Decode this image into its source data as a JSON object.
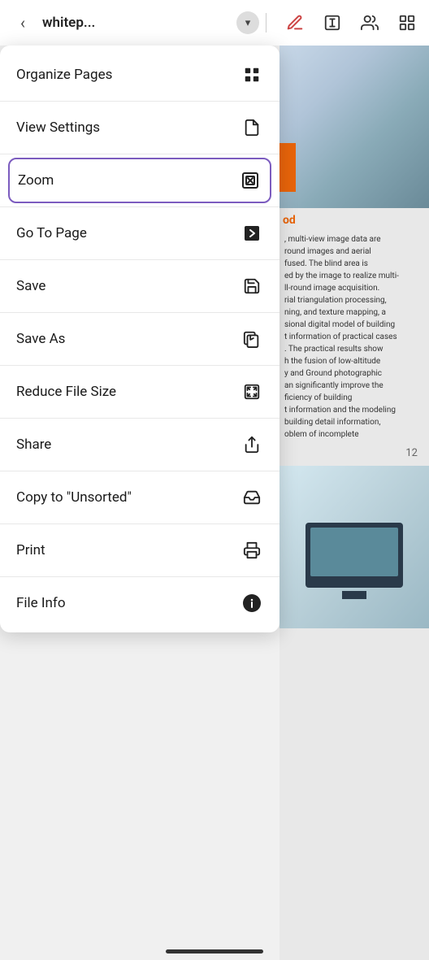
{
  "header": {
    "back_label": "‹",
    "title": "whitep...",
    "dropdown_icon": "▾",
    "icons": [
      {
        "name": "annotate-icon",
        "symbol": "✏️"
      },
      {
        "name": "text-tool-icon",
        "symbol": "T"
      },
      {
        "name": "share-people-icon",
        "symbol": "👥"
      },
      {
        "name": "apps-icon",
        "symbol": "⠿"
      }
    ]
  },
  "menu": {
    "items": [
      {
        "id": "organize-pages",
        "label": "Organize Pages",
        "icon": "grid-icon",
        "active": false
      },
      {
        "id": "view-settings",
        "label": "View Settings",
        "icon": "document-icon",
        "active": false
      },
      {
        "id": "zoom",
        "label": "Zoom",
        "icon": "zoom-icon",
        "active": true
      },
      {
        "id": "go-to-page",
        "label": "Go To Page",
        "icon": "arrow-right-icon",
        "active": false
      },
      {
        "id": "save",
        "label": "Save",
        "icon": "save-icon",
        "active": false
      },
      {
        "id": "save-as",
        "label": "Save As",
        "icon": "saveas-icon",
        "active": false
      },
      {
        "id": "reduce-file-size",
        "label": "Reduce File Size",
        "icon": "compress-icon",
        "active": false
      },
      {
        "id": "share",
        "label": "Share",
        "icon": "share-icon",
        "active": false
      },
      {
        "id": "copy-to-unsorted",
        "label": "Copy to \"Unsorted\"",
        "icon": "inbox-icon",
        "active": false
      },
      {
        "id": "print",
        "label": "Print",
        "icon": "print-icon",
        "active": false
      },
      {
        "id": "file-info",
        "label": "File Info",
        "icon": "info-icon",
        "active": false
      }
    ]
  },
  "page": {
    "number_top": "12",
    "number_bottom": "12",
    "text_content": ", multi-view image data are\nround images and aerial\nfused. The blind area is\ned by the image to realize multi-\nll-round image acquisition.\nrial triangulation processing,\nning, and texture mapping, a\nsional digital model of building\nt information of practical cases\n. The practical results show\nh the fusion of low-altitude\ny and Ground photographic\nan significantly improve the\nficiency of building\nt information and the modeling\nbuilding detail information,\noblem of incomplete",
    "orange_text": "od"
  },
  "colors": {
    "accent": "#7c5cbf",
    "active_border": "#7c5cbf",
    "orange": "#e8640a"
  }
}
